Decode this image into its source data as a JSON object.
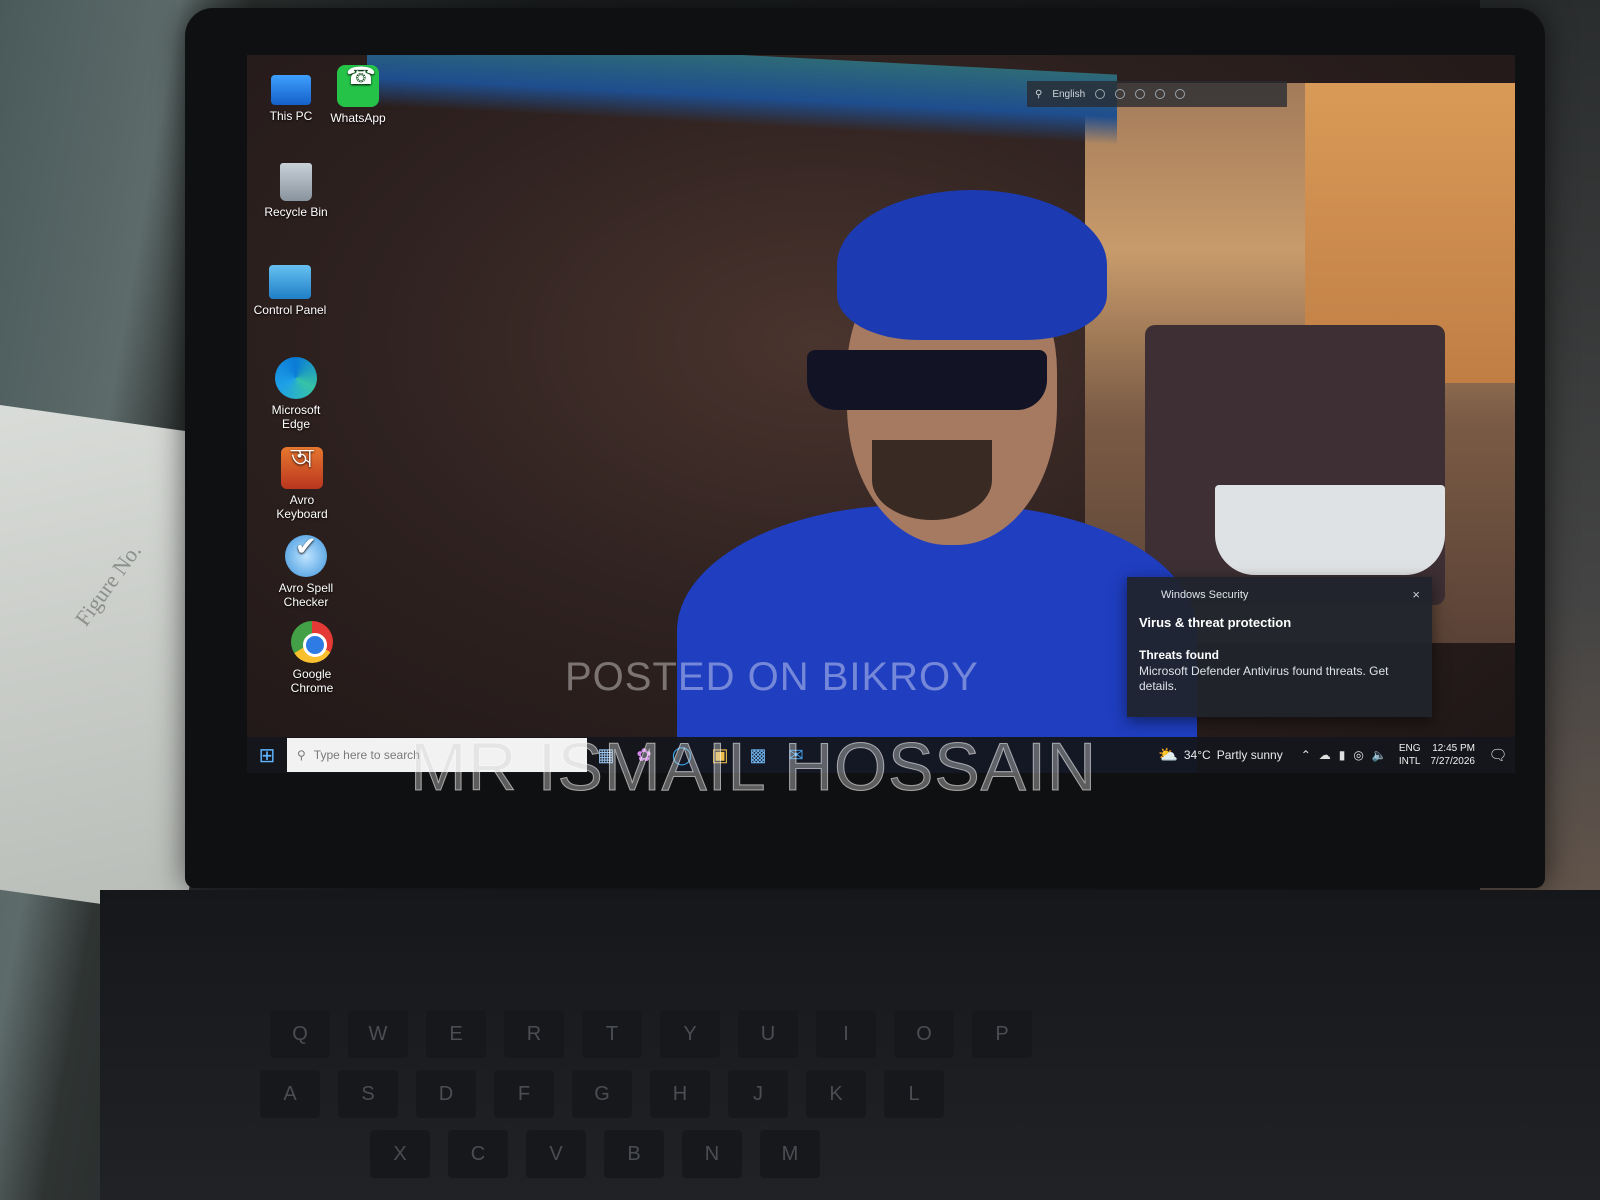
{
  "desktop": {
    "icons": [
      {
        "label": "This PC",
        "icon": "this-pc-icon"
      },
      {
        "label": "WhatsApp",
        "icon": "whatsapp-icon"
      },
      {
        "label": "Recycle Bin",
        "icon": "recycle-bin-icon"
      },
      {
        "label": "Control Panel",
        "icon": "control-panel-icon"
      },
      {
        "label": "Microsoft Edge",
        "icon": "edge-icon"
      },
      {
        "label": "Avro Keyboard",
        "icon": "avro-keyboard-icon"
      },
      {
        "label": "Avro Spell Checker",
        "icon": "avro-spell-checker-icon"
      },
      {
        "label": "Google Chrome",
        "icon": "chrome-icon"
      }
    ]
  },
  "language_bar": {
    "label": "English"
  },
  "toast": {
    "app": "Windows Security",
    "title": "Virus & threat protection",
    "subtitle": "Threats found",
    "body": "Microsoft Defender Antivirus found threats. Get details.",
    "close": "×"
  },
  "taskbar": {
    "search_placeholder": "Type here to search",
    "weather_temp": "34°C",
    "weather_text": "Partly sunny",
    "lang_top": "ENG",
    "lang_bottom": "INTL",
    "time": "12:45 PM",
    "date": "7/27/2026"
  },
  "keyboard": {
    "row1": [
      "Q",
      "W",
      "E",
      "R",
      "T",
      "Y",
      "U",
      "I",
      "O",
      "P"
    ],
    "row2": [
      "A",
      "S",
      "D",
      "F",
      "G",
      "H",
      "J",
      "K",
      "L"
    ],
    "row3": [
      "X",
      "C",
      "V",
      "B",
      "N",
      "M"
    ]
  },
  "watermarks": {
    "posted": "POSTED ON BIKROY",
    "owner": "MR ISMAIL HOSSAIN"
  },
  "paper_note": "Figure No.",
  "colors": {
    "taskbar_bg": "#14161c",
    "toast_bg": "#20242c",
    "shirt_blue": "#1f3ec0"
  }
}
